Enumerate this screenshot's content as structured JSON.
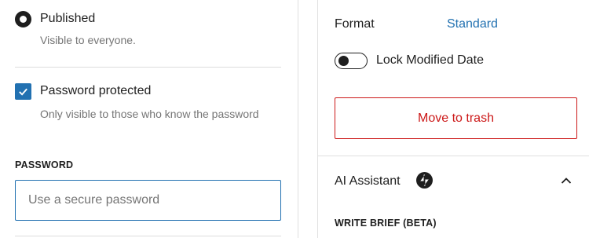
{
  "visibility": {
    "published": {
      "label": "Published",
      "description": "Visible to everyone."
    },
    "password_protected": {
      "label": "Password protected",
      "description": "Only visible to those who know the password",
      "checked": true
    },
    "password": {
      "label": "PASSWORD",
      "placeholder": "Use a secure password",
      "value": ""
    }
  },
  "sidebar": {
    "format": {
      "label": "Format",
      "value": "Standard"
    },
    "lock_modified_date": {
      "label": "Lock Modified Date",
      "enabled": false
    },
    "trash_label": "Move to trash",
    "ai_assistant": {
      "title": "AI Assistant",
      "section_label": "WRITE BRIEF (BETA)"
    }
  },
  "colors": {
    "accent": "#2271b1",
    "danger": "#cc1818",
    "text": "#1e1e1e",
    "muted": "#757575"
  },
  "icons": [
    "radio-selected-icon",
    "checkbox-checked-icon",
    "jetpack-bolt-icon",
    "chevron-up-icon"
  ]
}
